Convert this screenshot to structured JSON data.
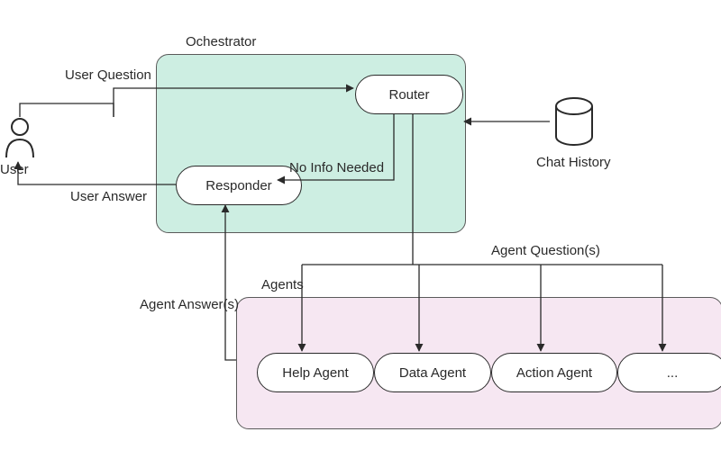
{
  "user": {
    "label": "User"
  },
  "orchestrator": {
    "title": "Ochestrator",
    "router": "Router",
    "responder": "Responder"
  },
  "chat_history": {
    "label": "Chat History"
  },
  "agents": {
    "title": "Agents",
    "items": [
      {
        "label": "Help Agent"
      },
      {
        "label": "Data Agent"
      },
      {
        "label": "Action Agent"
      },
      {
        "label": "..."
      }
    ]
  },
  "edges": {
    "user_question": "User Question",
    "user_answer": "User Answer",
    "no_info_needed": "No Info Needed",
    "agent_questions": "Agent Question(s)",
    "agent_answers": "Agent Answer(s)"
  }
}
